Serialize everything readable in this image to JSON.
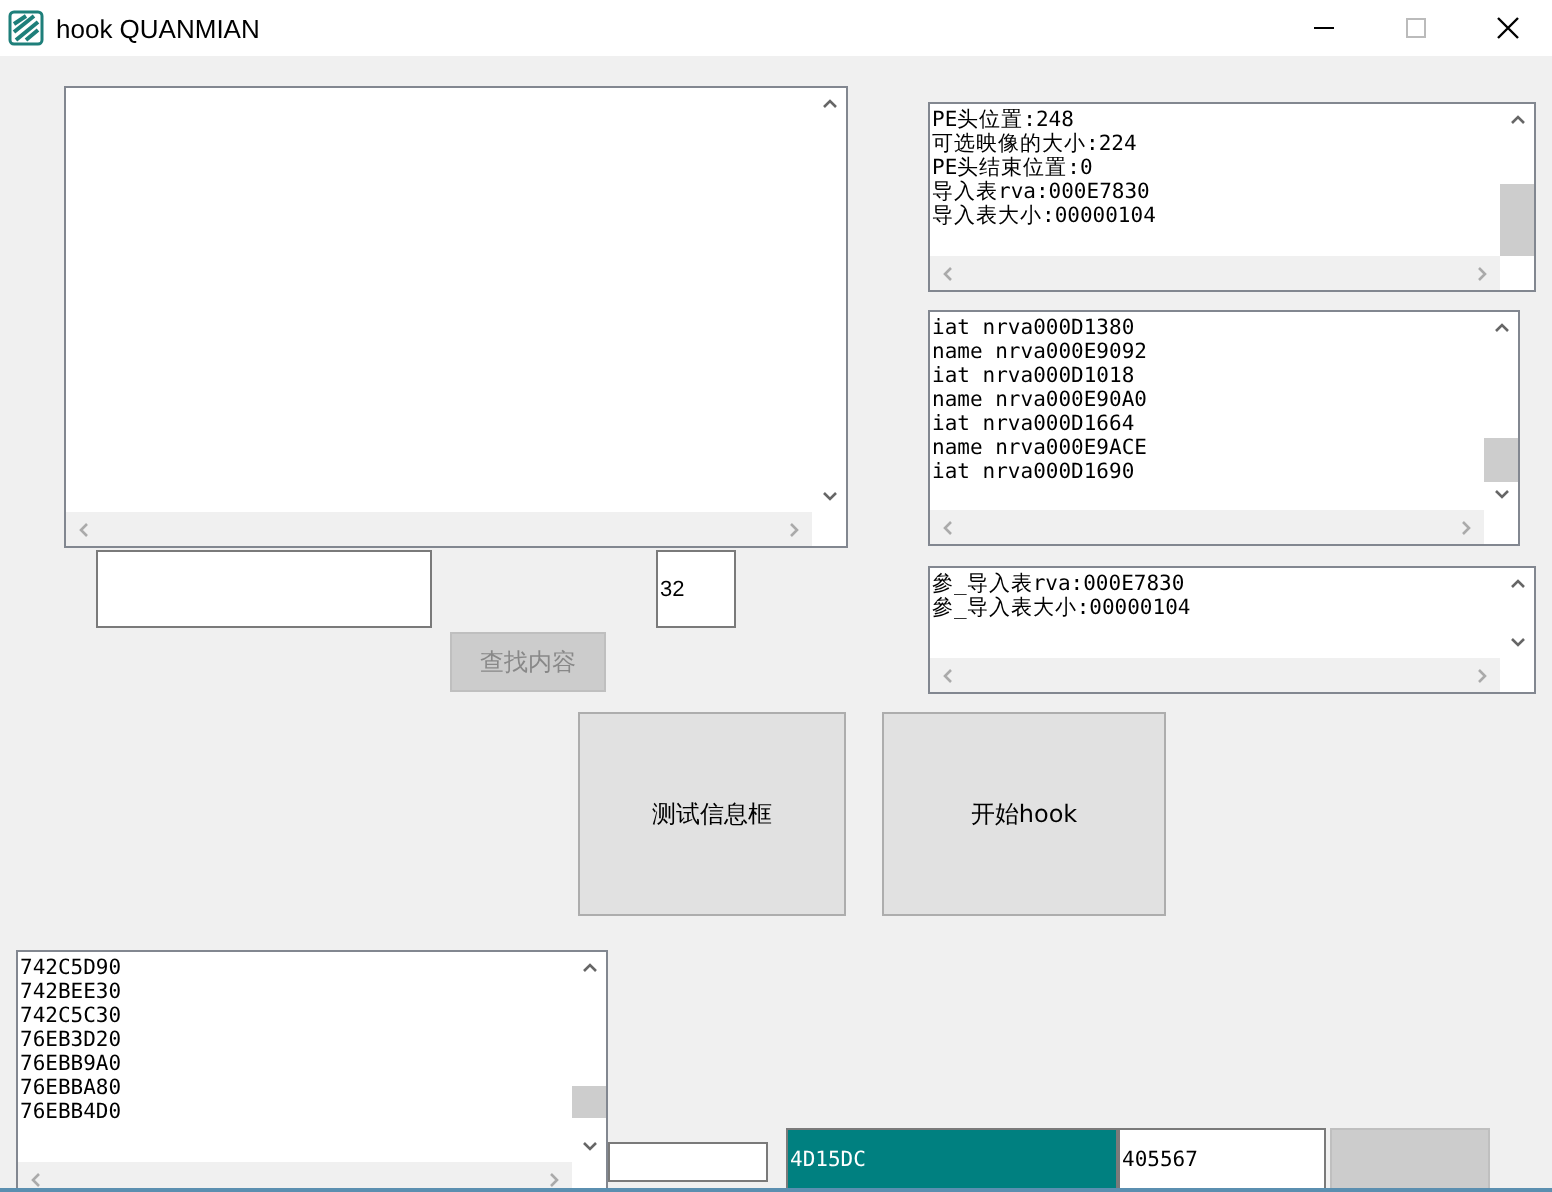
{
  "window": {
    "title": "hook QUANMIAN"
  },
  "count_field": {
    "value": "32"
  },
  "search_button": {
    "label": "查找内容",
    "disabled": true
  },
  "pe_info": {
    "lines": [
      "PE头位置:248",
      "可选映像的大小:224",
      "PE头结束位置:0",
      "导入表rva:000E7830",
      "导入表大小:00000104"
    ]
  },
  "import_entries": {
    "lines": [
      "iat nrva000D1380",
      "name nrva000E9092",
      "iat nrva000D1018",
      "name nrva000E90A0",
      "iat nrva000D1664",
      "name nrva000E9ACE",
      "iat nrva000D1690"
    ]
  },
  "param_info": {
    "lines": [
      "參_导入表rva:000E7830",
      "參_导入表大小:00000104"
    ]
  },
  "buttons": [
    {
      "label": "测试信息框"
    },
    {
      "label": "开始hook"
    }
  ],
  "address_list": {
    "lines": [
      "742C5D90",
      "742BEE30",
      "742C5C30",
      "76EB3D20",
      "76EBB9A0",
      "76EBBA80",
      "76EBB4D0"
    ]
  },
  "address_field": {
    "value": "4D15DC",
    "highlighted": true
  },
  "value_field": {
    "value": "405567",
    "highlighted": false
  },
  "bottom_button": {
    "disabled": true
  }
}
